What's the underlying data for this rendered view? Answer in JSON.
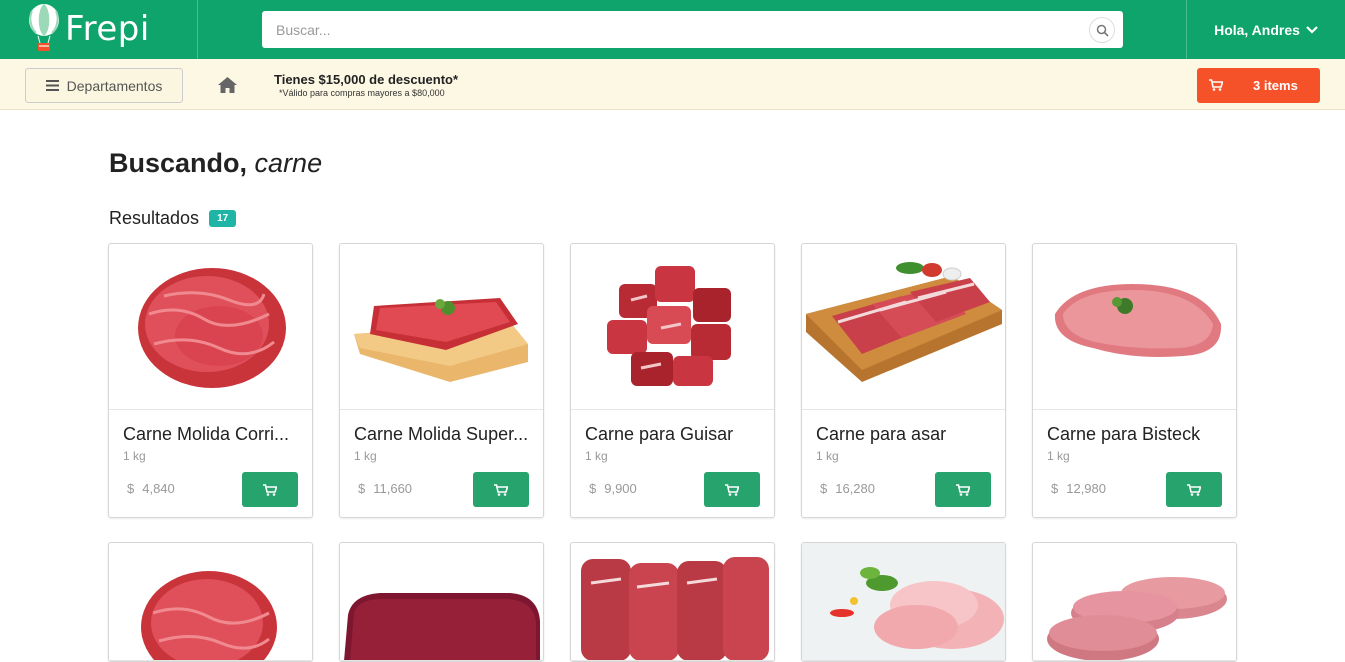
{
  "header": {
    "logo_text": "Frepi",
    "search_placeholder": "Buscar...",
    "user_greeting": "Hola, Andres"
  },
  "promo": {
    "departments_label": "Departamentos",
    "discount_title": "Tienes $15,000 de descuento*",
    "discount_note": "*Válido para compras mayores a $80,000",
    "cart_label": "3 items"
  },
  "search": {
    "prefix": "Buscando,",
    "query": "carne",
    "results_label": "Resultados",
    "results_count": "17"
  },
  "products": [
    {
      "name": "Carne Molida Corri...",
      "unit": "1 kg",
      "currency": "$",
      "price": "4,840"
    },
    {
      "name": "Carne Molida Super...",
      "unit": "1 kg",
      "currency": "$",
      "price": "11,660"
    },
    {
      "name": "Carne para Guisar",
      "unit": "1 kg",
      "currency": "$",
      "price": "9,900"
    },
    {
      "name": "Carne para asar",
      "unit": "1 kg",
      "currency": "$",
      "price": "16,280"
    },
    {
      "name": "Carne para Bisteck",
      "unit": "1 kg",
      "currency": "$",
      "price": "12,980"
    }
  ],
  "colors": {
    "brand_green": "#0fa46c",
    "cart_orange": "#f5522a",
    "add_button_green": "#27a36e",
    "badge_teal": "#1fb5a6",
    "promo_background": "#fdf8e4"
  },
  "icons": {
    "logo": "balloon-icon",
    "search": "search-icon",
    "user_menu": "chevron-down-icon",
    "departments": "menu-icon",
    "home": "home-icon",
    "cart": "cart-icon"
  }
}
